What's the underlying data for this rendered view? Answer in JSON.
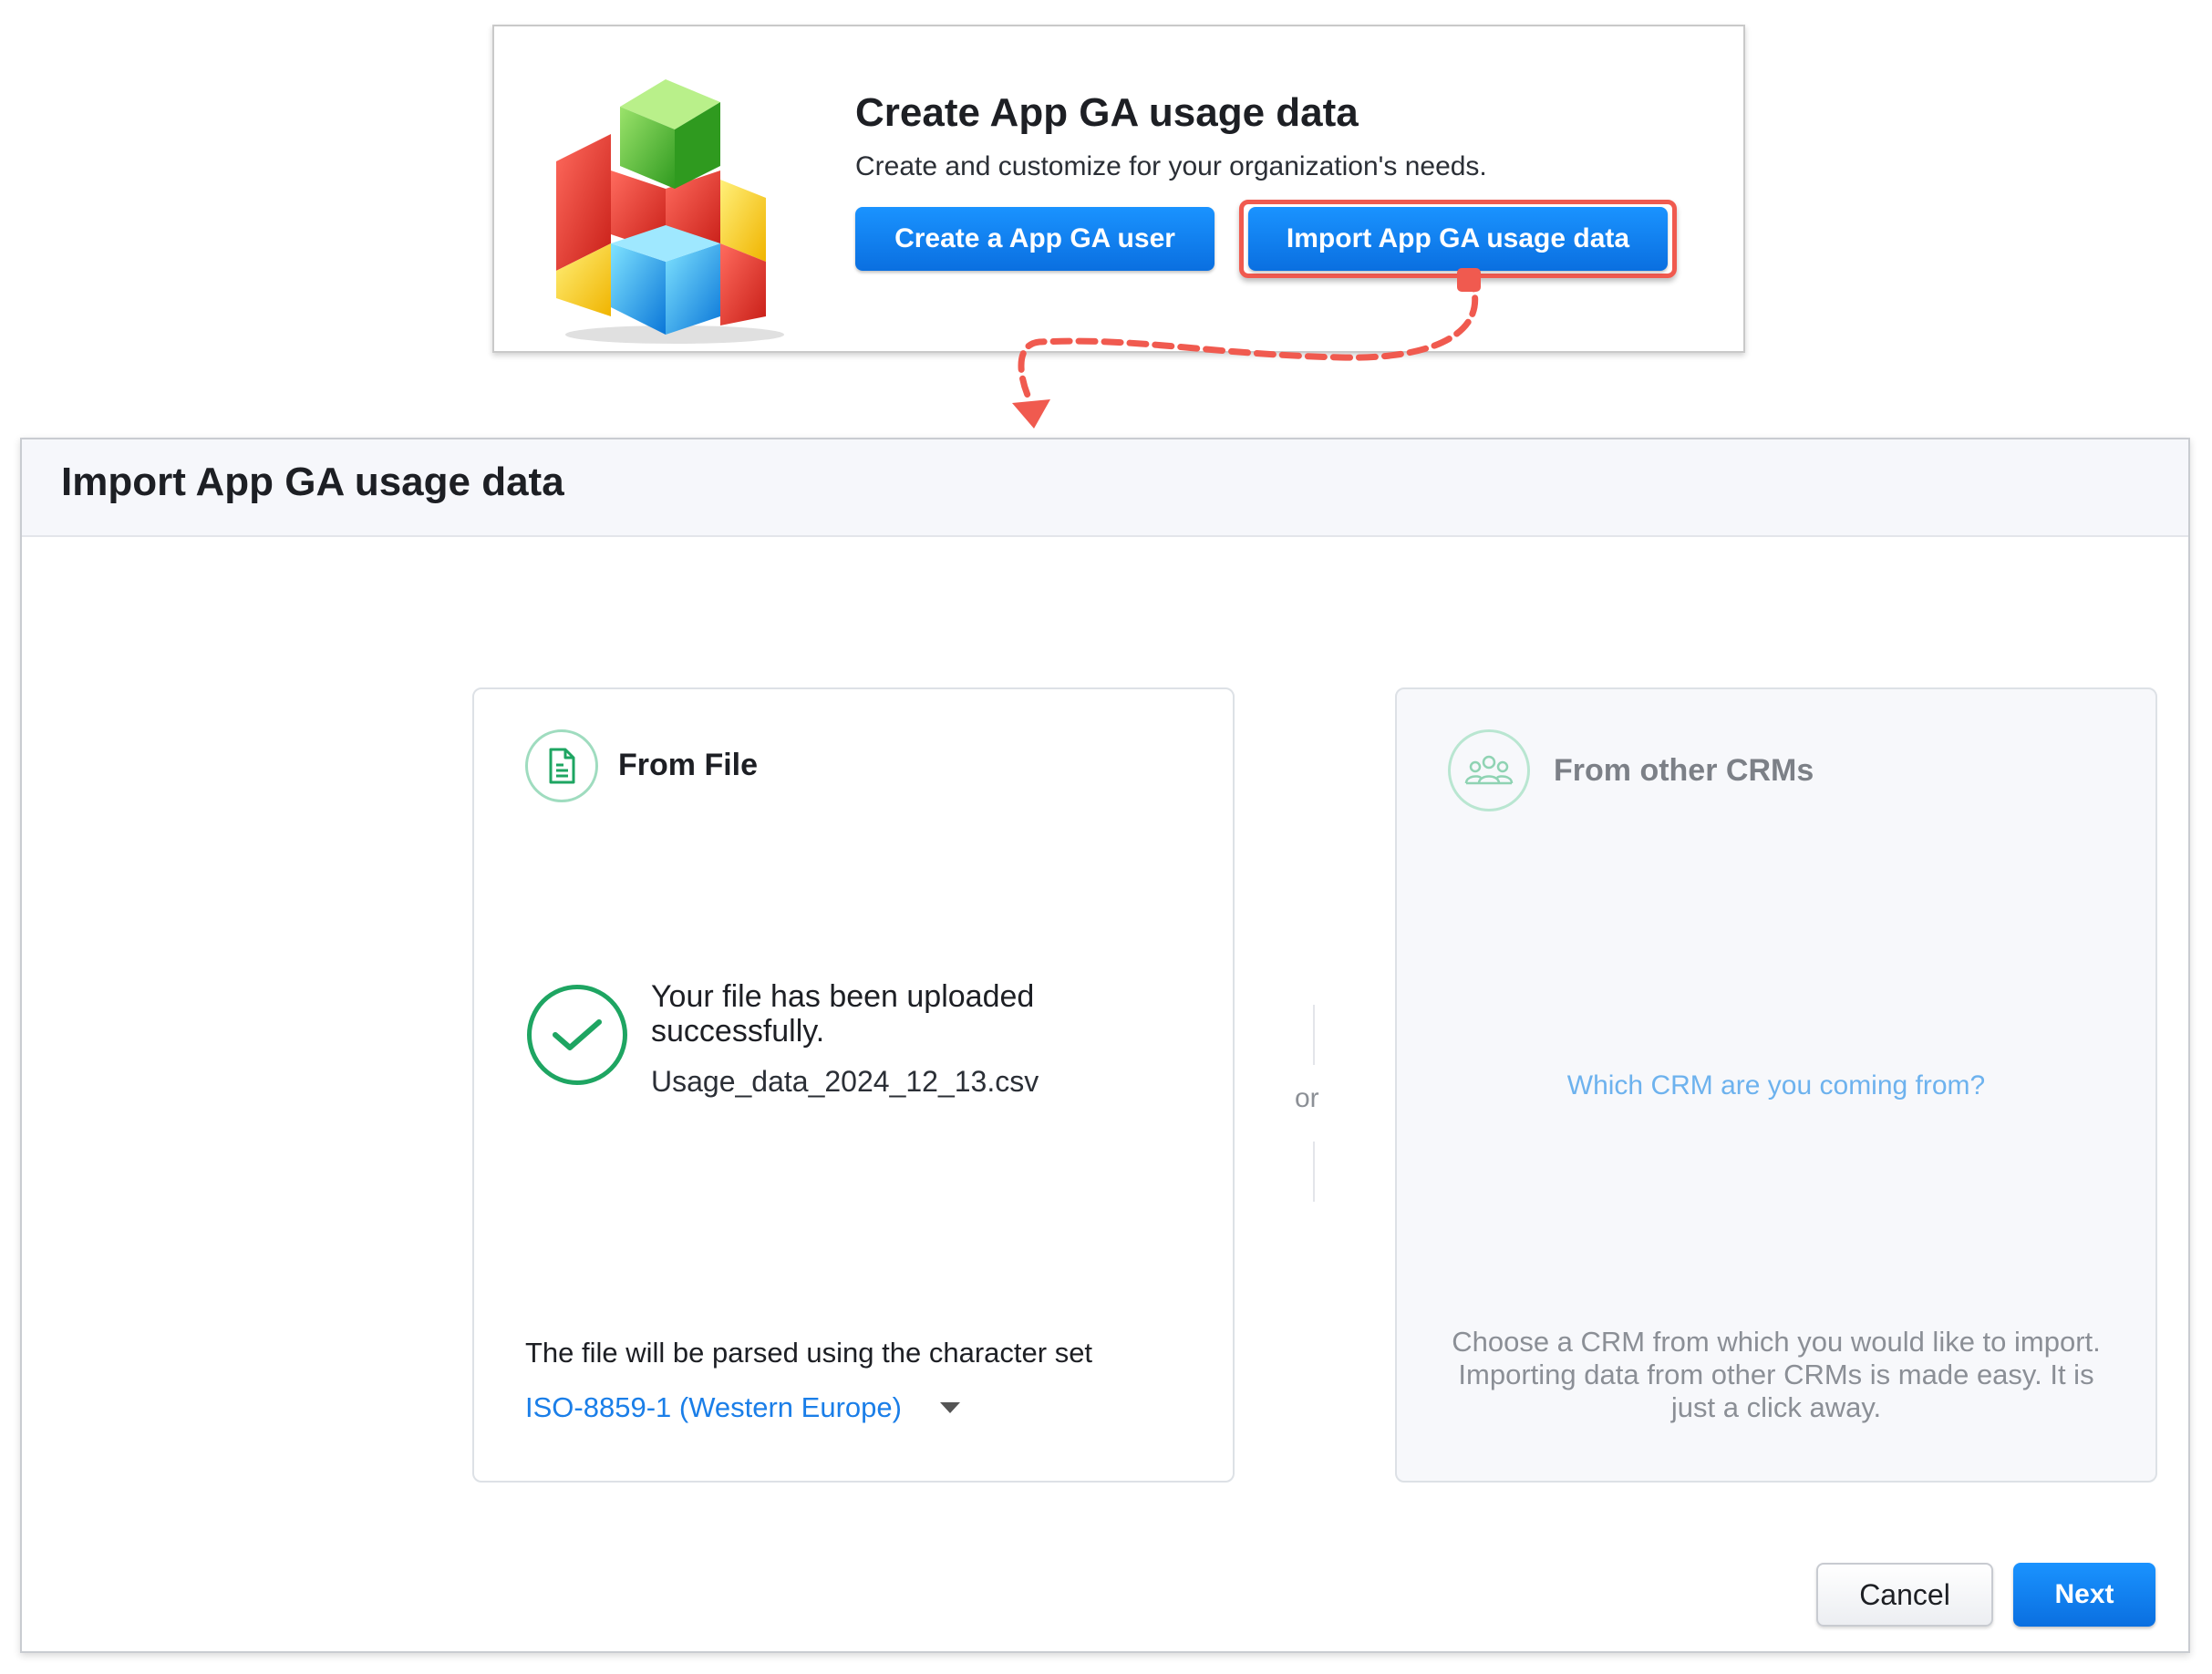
{
  "top_card": {
    "title": "Create App GA usage data",
    "subtitle": "Create and customize for your organization's needs.",
    "create_button": "Create a App GA user",
    "import_button": "Import App GA usage data"
  },
  "import_dialog": {
    "title": "Import App GA usage data",
    "from_file": {
      "title": "From File",
      "upload_message": "Your file has been uploaded successfully.",
      "file_name": "Usage_data_2024_12_13.csv",
      "charset_label": "The file will be parsed using the character set",
      "charset_value": "ISO-8859-1 (Western Europe)"
    },
    "separator": "or",
    "from_crm": {
      "title": "From other CRMs",
      "question": "Which CRM are you coming from?",
      "description": "Choose a CRM from which you would like to import. Importing data from other CRMs is made easy. It is just a click away."
    },
    "cancel_button": "Cancel",
    "next_button": "Next"
  },
  "colors": {
    "primary_button": "#0a7cf0",
    "highlight": "#f05a4f",
    "success": "#1ea562",
    "link": "#1a7ee8"
  }
}
